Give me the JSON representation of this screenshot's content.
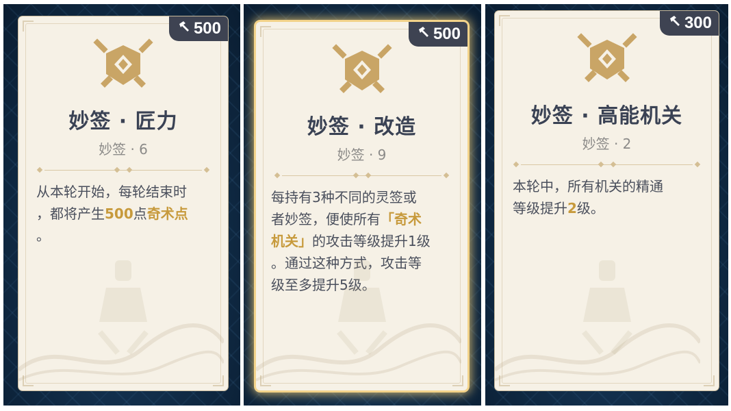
{
  "colors": {
    "accent_gold": "#c79a3c",
    "title_text": "#3a4254",
    "badge_bg": "#3e4352",
    "card_bg": "#f6f1e6",
    "highlight_glow": "#f3d38a"
  },
  "icons": {
    "cost": "hammer-icon",
    "emblem": "crossed-swords-shield-emblem"
  },
  "cards": [
    {
      "cost": "500",
      "title": "妙签 · 匠力",
      "subtitle": "妙签 · 6",
      "desc": {
        "line1": "从本轮开始，每轮结束时",
        "line2_pre": "，都将产生",
        "line2_hl1": "500",
        "line2_mid": "点",
        "line2_hl2": "奇术点",
        "line3": "。"
      },
      "selected": false
    },
    {
      "cost": "500",
      "title": "妙签 · 改造",
      "subtitle": "妙签 · 9",
      "desc": {
        "line1": "每持有3种不同的灵签或",
        "line2_pre": "者妙签，便使所有",
        "line2_hl": "「奇术",
        "line3_hl": "机关」",
        "line3_post": "的攻击等级提升1级",
        "line4": "。通过这种方式，攻击等",
        "line5": "级至多提升5级。"
      },
      "selected": true
    },
    {
      "cost": "300",
      "title": "妙签 · 高能机关",
      "subtitle": "妙签 · 2",
      "desc": {
        "line1": "本轮中，所有机关的精通",
        "line2_pre": "等级提升",
        "line2_hl": "2",
        "line2_post": "级。"
      },
      "selected": false
    }
  ]
}
